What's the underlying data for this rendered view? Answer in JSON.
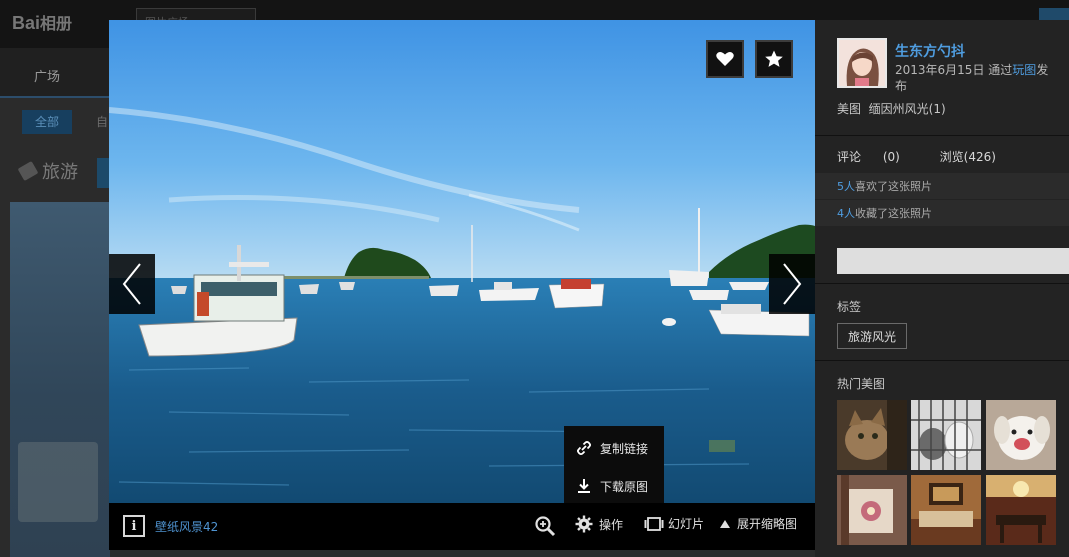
{
  "background": {
    "logo_text": "Bai",
    "logo_cn": "相册",
    "search_text": "图片广场",
    "nav_tab": "广场",
    "filter_all": "全部",
    "filter_next": "自",
    "tag_title": "旅游"
  },
  "viewer": {
    "actions": {
      "like": "heart-icon",
      "favorite": "star-icon"
    },
    "popup": {
      "copy_link": "复制链接",
      "download_original": "下载原图"
    },
    "toolbar": {
      "album_name": "壁纸风景42",
      "operate_label": "操作",
      "slideshow_label": "幻灯片",
      "expand_thumbs_label": "展开缩略图"
    }
  },
  "side": {
    "username": "生东方勺抖",
    "publish_date": "2013年6月15日",
    "publish_via_prefix": "通过",
    "publish_via_link": "玩图",
    "publish_suffix": "发布",
    "category_primary": "美图",
    "category_secondary": "缅因州风光(1)",
    "comments_label": "评论",
    "comments_count": "(0)",
    "views_label": "浏览(426)",
    "likes_count": "5人",
    "likes_text": "喜欢了这张照片",
    "favs_count": "4人",
    "favs_text": "收藏了这张照片",
    "tags_label": "标签",
    "tag_item": "旅游风光",
    "hot_label": "热门美图"
  },
  "colors": {
    "accent_link": "#4f9de0",
    "panel_bg": "#232323",
    "viewer_bg": "#000000"
  }
}
